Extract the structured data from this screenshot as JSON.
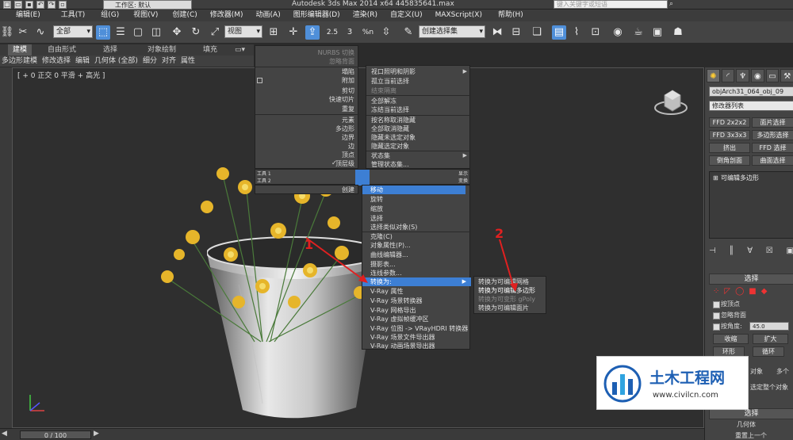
{
  "titlebar": {
    "workspace": "工作区: 默认",
    "app_title": "Autodesk 3ds Max  2014 x64    445835641.max",
    "search_placeholder": "键入关键字或短语"
  },
  "menu": [
    "编辑(E)",
    "工具(T)",
    "组(G)",
    "视图(V)",
    "创建(C)",
    "修改器(M)",
    "动画(A)",
    "图形编辑器(D)",
    "渲染(R)",
    "自定义(U)",
    "MAXScript(X)",
    "帮助(H)"
  ],
  "toolbar": {
    "filter_select": "全部",
    "ref_coord_select": "视图",
    "named_sel_select": "创建选择集",
    "snap_label": "2.5",
    "angle_snap_label": "3",
    "percent_snap_label": "%n"
  },
  "ribbon": {
    "tabs": [
      "建模",
      "自由形式",
      "选择",
      "对象绘制",
      "填充"
    ],
    "active_tab": "建模",
    "sub": [
      "多边形建模",
      "修改选择",
      "编辑",
      "几何体 (全部)",
      "细分",
      "对齐",
      "属性"
    ]
  },
  "viewport": {
    "label": "[ + 0 正交 0 平滑 + 高光 ]"
  },
  "quad_left_top": [
    {
      "label": "NURBS 切换",
      "state": "dim"
    },
    {
      "label": "忽略背面",
      "state": "dim"
    },
    {
      "label": "塌陷",
      "state": "lit"
    },
    {
      "label": "附加",
      "state": "lit"
    },
    {
      "label": "剪切",
      "state": "lit"
    },
    {
      "label": "快速切片",
      "state": "lit"
    },
    {
      "label": "重复",
      "state": "lit"
    },
    {
      "label": "元素",
      "state": "lit"
    },
    {
      "label": "多边形",
      "state": "lit"
    },
    {
      "label": "边界",
      "state": "lit"
    },
    {
      "label": "边",
      "state": "lit"
    },
    {
      "label": "顶点",
      "state": "lit"
    },
    {
      "label": "顶层级",
      "state": "lit"
    }
  ],
  "quad_left_tools": [
    "工具 1",
    "工具 2"
  ],
  "quad_right_tools": [
    "显示",
    "变换"
  ],
  "quad_left_bottom": "创建",
  "quad_right_top": [
    "视口照明和阴影",
    "孤立当前选择",
    "结束隔离",
    "全部解冻",
    "冻结当前选择",
    "按名称取消隐藏",
    "全部取消隐藏",
    "隐藏未选定对象",
    "隐藏选定对象",
    "状态集",
    "管理状态集..."
  ],
  "quad_right_bottom": [
    {
      "label": "移动",
      "state": "hl"
    },
    {
      "label": "旋转",
      "state": "lit"
    },
    {
      "label": "缩放",
      "state": "lit"
    },
    {
      "label": "选择",
      "state": "lit"
    },
    {
      "label": "选择类似对象(S)",
      "state": "lit"
    },
    {
      "label": "克隆(C)",
      "state": "lit"
    },
    {
      "label": "对象属性(P)...",
      "state": "lit"
    },
    {
      "label": "曲线编辑器...",
      "state": "lit"
    },
    {
      "label": "摄影表...",
      "state": "lit"
    },
    {
      "label": "连线参数...",
      "state": "lit"
    },
    {
      "label": "转换为:",
      "state": "hl"
    },
    {
      "label": "V-Ray 属性",
      "state": "lit"
    },
    {
      "label": "V-Ray 场景转换器",
      "state": "lit"
    },
    {
      "label": "V-Ray 网格导出",
      "state": "lit"
    },
    {
      "label": "V-Ray 虚拟帧缓冲区",
      "state": "lit"
    },
    {
      "label": "V-Ray 位图 -> VRayHDRI 转换器",
      "state": "lit"
    },
    {
      "label": "V-Ray 场景文件导出器",
      "state": "lit"
    },
    {
      "label": "V-Ray 动画场景导出器",
      "state": "lit"
    }
  ],
  "convert_submenu": [
    "转换为可编辑网格",
    "转换为可编辑多边形",
    "转换为可变形 gPoly",
    "转换为可编辑面片"
  ],
  "annotations": [
    "1",
    "2"
  ],
  "right_panel": {
    "object_name": "objArch31_064_obj_09",
    "modifier_list": "修改器列表",
    "buttons": [
      [
        "FFD 2x2x2",
        "面片选择"
      ],
      [
        "FFD 3x3x3",
        "多边形选择"
      ],
      [
        "挤出",
        "FFD 选择"
      ],
      [
        "倒角剖面",
        "曲面选择"
      ]
    ],
    "stack_item": "可编辑多边形",
    "rollout_title": "选择",
    "check_items": [
      "按顶点",
      "忽略背面",
      "按角度:"
    ],
    "angle_value": "45.0",
    "btn_shrink": "收缩",
    "btn_grow": "扩大",
    "btn_ring": "环形",
    "btn_loop": "循环",
    "bottom_rollout": "选择",
    "bottom_text_1": "几何体",
    "bottom_text_2": "重置上一个",
    "whole_object": "选定整个对象",
    "by_object": "对象",
    "multi": "多个"
  },
  "timeline": {
    "slider": "0 / 100"
  },
  "watermark": {
    "title": "土木工程网",
    "url": "www.civilcn.com"
  }
}
